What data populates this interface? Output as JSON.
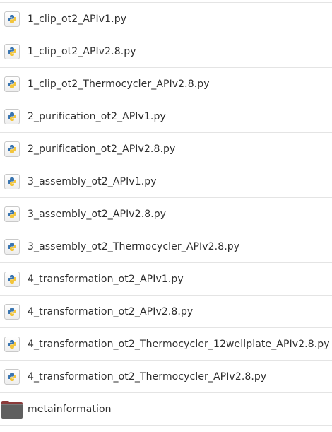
{
  "files": [
    {
      "name": "1_clip_ot2_APIv1.py",
      "icon": "python-file-icon"
    },
    {
      "name": "1_clip_ot2_APIv2.8.py",
      "icon": "python-file-icon"
    },
    {
      "name": "1_clip_ot2_Thermocycler_APIv2.8.py",
      "icon": "python-file-icon"
    },
    {
      "name": "2_purification_ot2_APIv1.py",
      "icon": "python-file-icon"
    },
    {
      "name": "2_purification_ot2_APIv2.8.py",
      "icon": "python-file-icon"
    },
    {
      "name": "3_assembly_ot2_APIv1.py",
      "icon": "python-file-icon"
    },
    {
      "name": "3_assembly_ot2_APIv2.8.py",
      "icon": "python-file-icon"
    },
    {
      "name": "3_assembly_ot2_Thermocycler_APIv2.8.py",
      "icon": "python-file-icon"
    },
    {
      "name": "4_transformation_ot2_APIv1.py",
      "icon": "python-file-icon"
    },
    {
      "name": "4_transformation_ot2_APIv2.8.py",
      "icon": "python-file-icon"
    },
    {
      "name": "4_transformation_ot2_Thermocycler_12wellplate_APIv2.8.py",
      "icon": "python-file-icon"
    },
    {
      "name": "4_transformation_ot2_Thermocycler_APIv2.8.py",
      "icon": "python-file-icon"
    },
    {
      "name": "metainformation",
      "icon": "folder-icon"
    }
  ],
  "colors": {
    "python_blue": "#3a75b0",
    "python_yellow": "#f2c53d",
    "folder_body": "#5f5f5f",
    "folder_tab": "#8b3a3a",
    "text": "#2e2e2e",
    "separator": "#e4e4e4"
  }
}
